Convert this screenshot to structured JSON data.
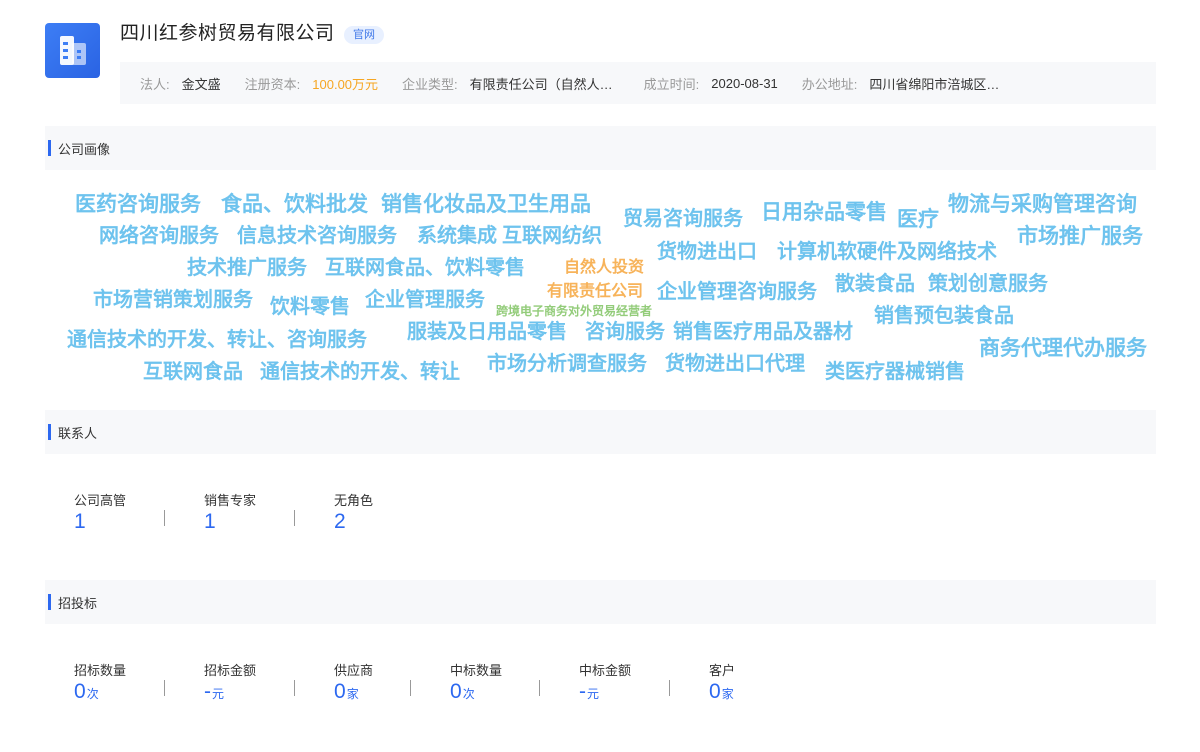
{
  "header": {
    "company_name": "四川红参树贸易有限公司",
    "official_tag": "官网",
    "info": [
      {
        "label": "法人:",
        "value": "金文盛"
      },
      {
        "label": "注册资本:",
        "value": "100.00万元"
      },
      {
        "label": "企业类型:",
        "value": "有限责任公司（自然人投资或控股）"
      },
      {
        "label": "成立时间:",
        "value": "2020-08-31"
      },
      {
        "label": "办公地址:",
        "value": "四川省绵阳市涪城区青龙大道中段"
      }
    ],
    "colors": {
      "accent": "#2c68f0",
      "money": "#f6a623"
    },
    "logo_icon": "building-icon"
  },
  "sections": {
    "portrait": "公司画像",
    "contacts": "联系人",
    "bidding": "招投标"
  },
  "word_cloud": [
    "医药咨询服务",
    "食品、饮料批发",
    "销售化妆品及卫生用品",
    "贸易咨询服务",
    "日用杂品零售",
    "医疗",
    "物流与采购管理咨询",
    "网络咨询服务",
    "信息技术咨询服务",
    "系统集成",
    "互联网纺织",
    "货物进出口",
    "计算机软硬件及网络技术",
    "市场推广服务",
    "技术推广服务",
    "互联网食品、饮料零售",
    "自然人投资",
    "市场营销策划服务",
    "饮料零售",
    "企业管理服务",
    "有限责任公司",
    "企业管理咨询服务",
    "散装食品",
    "策划创意服务",
    "跨境电子商务对外贸易经营者",
    "通信技术的开发、转让、咨询服务",
    "服装及日用品零售",
    "咨询服务",
    "销售医疗用品及器材",
    "销售预包装食品",
    "商务代理代办服务",
    "互联网食品",
    "通信技术的开发、转让",
    "市场分析调查服务",
    "货物进出口代理",
    "类医疗器械销售"
  ],
  "contacts": [
    {
      "label": "公司高管",
      "value": "1"
    },
    {
      "label": "销售专家",
      "value": "1"
    },
    {
      "label": "无角色",
      "value": "2"
    }
  ],
  "bidding": [
    {
      "label": "招标数量",
      "value": "0",
      "unit": "次"
    },
    {
      "label": "招标金额",
      "value": "-",
      "unit": "元"
    },
    {
      "label": "供应商",
      "value": "0",
      "unit": "家"
    },
    {
      "label": "中标数量",
      "value": "0",
      "unit": "次"
    },
    {
      "label": "中标金额",
      "value": "-",
      "unit": "元"
    },
    {
      "label": "客户",
      "value": "0",
      "unit": "家"
    }
  ]
}
